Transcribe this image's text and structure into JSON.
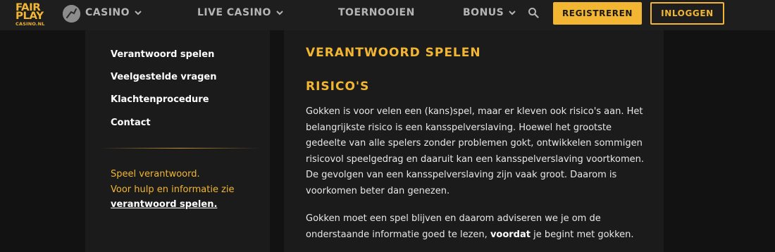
{
  "header": {
    "logo": {
      "line1": "FAIR",
      "line2": "PLAY",
      "line3": "CASINO.NL"
    },
    "nav": [
      {
        "label": "CASINO",
        "dropdown": true
      },
      {
        "label": "LIVE CASINO",
        "dropdown": true
      },
      {
        "label": "TOERNOOIEN",
        "dropdown": false
      },
      {
        "label": "BONUS",
        "dropdown": true
      }
    ],
    "register_label": "REGISTREREN",
    "login_label": "INLOGGEN"
  },
  "sidebar": {
    "items": [
      {
        "label": "Verantwoord spelen"
      },
      {
        "label": "Veelgestelde vragen"
      },
      {
        "label": "Klachtenprocedure"
      },
      {
        "label": "Contact"
      }
    ],
    "note_line1": "Speel verantwoord.",
    "note_line2": "Voor hulp en informatie zie",
    "note_link": "verantwoord spelen."
  },
  "main": {
    "title": "VERANTWOORD SPELEN",
    "subtitle": "RISICO'S",
    "paragraph1": "Gokken is voor velen een (kans)spel, maar er kleven ook risico's aan. Het belangrijkste risico is een kansspelverslaving. Hoewel het grootste gedeelte van alle spelers zonder problemen gokt, ontwikkelen sommigen risicovol speelgedrag en daaruit kan een kansspelverslaving voortkomen. De gevolgen van een kansspelverslaving zijn vaak groot. Daarom is voorkomen beter dan genezen.",
    "paragraph2_before": "Gokken moet een spel blijven en daarom adviseren we je om de onderstaande informatie goed te lezen, ",
    "paragraph2_bold": "voordat",
    "paragraph2_after": " je begint met gokken."
  },
  "colors": {
    "accent": "#f2b632",
    "header_bg": "#1e1e1e",
    "panel_bg": "#1b1b1b",
    "page_bg": "#121212"
  },
  "icons": [
    "user-chip-icon",
    "chevron-down-icon",
    "search-icon"
  ]
}
